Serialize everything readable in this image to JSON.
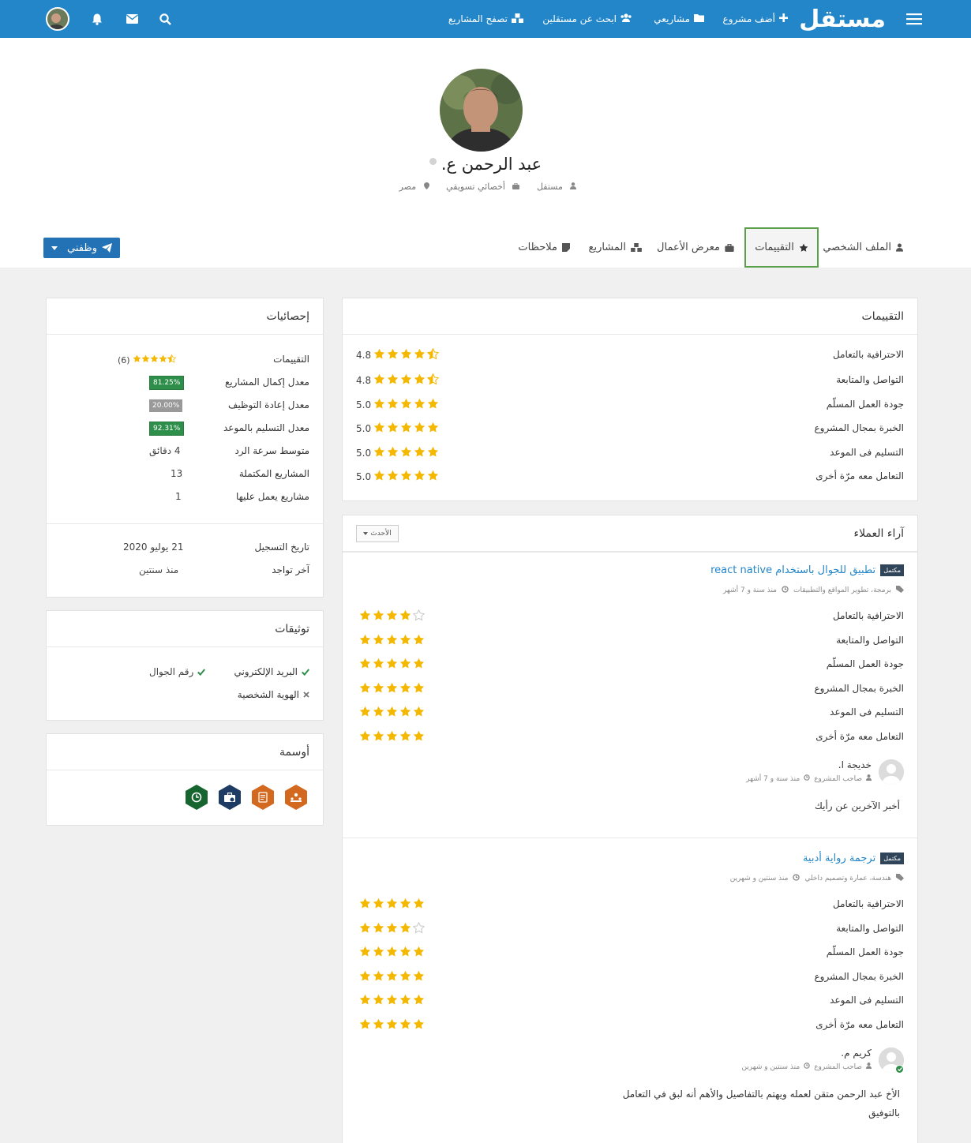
{
  "colors": {
    "primary": "#2386c8",
    "star": "#f5b800",
    "green": "#2e8f4b",
    "active_tab_border": "#5ba14b",
    "hire_button": "#2372b5"
  },
  "nav": {
    "logo": "مستقل",
    "add_project": "أضف مشروع",
    "my_projects": "مشاريعي",
    "find_freelancers": "ابحث عن مستقلين",
    "browse_projects": "تصفح المشاريع",
    "icons": [
      "menu-icon",
      "plus-icon",
      "folder-icon",
      "users-icon",
      "cubes-icon",
      "search-icon",
      "envelope-icon",
      "bell-icon"
    ]
  },
  "profile": {
    "name": "عبد الرحمن ع.",
    "site": "مستقل",
    "job": "أخصائي تسويقي",
    "country": "مصر"
  },
  "tabs": [
    "الملف الشخصي",
    "التقييمات",
    "معرض الأعمال",
    "المشاريع",
    "ملاحظات"
  ],
  "active_tab": "التقييمات",
  "hire_button": "وظفني",
  "ratings": {
    "title": "التقييمات",
    "items": [
      {
        "label": "الاحترافية بالتعامل",
        "value": "4.8",
        "stars": 4.5
      },
      {
        "label": "التواصل والمتابعة",
        "value": "4.8",
        "stars": 4.5
      },
      {
        "label": "جودة العمل المسلّم",
        "value": "5.0",
        "stars": 5
      },
      {
        "label": "الخبرة بمجال المشروع",
        "value": "5.0",
        "stars": 5
      },
      {
        "label": "التسليم فى الموعد",
        "value": "5.0",
        "stars": 5
      },
      {
        "label": "التعامل معه مرّة أخرى",
        "value": "5.0",
        "stars": 5
      }
    ]
  },
  "reviews": {
    "title": "آراء العملاء",
    "sort": "الأحدث",
    "items": [
      {
        "status": "مكتمل",
        "title": "تطبيق للجوال باستخدام react native",
        "tags": "برمجة، تطوير المواقع والتطبيقات",
        "time": "منذ سنة و 7 أشهر",
        "criteria": [
          {
            "label": "الاحترافية بالتعامل",
            "stars": 4
          },
          {
            "label": "التواصل والمتابعة",
            "stars": 5
          },
          {
            "label": "جودة العمل المسلّم",
            "stars": 5
          },
          {
            "label": "الخبرة بمجال المشروع",
            "stars": 5
          },
          {
            "label": "التسليم فى الموعد",
            "stars": 5
          },
          {
            "label": "التعامل معه مرّة أخرى",
            "stars": 5
          }
        ],
        "reviewer": "خديجة ا.",
        "role": "صاحب المشروع",
        "review_time": "منذ سنة و 7 أشهر",
        "comment": "أخبر الآخرين عن رأيك"
      },
      {
        "status": "مكتمل",
        "title": "ترجمة رواية أدبية",
        "tags": "هندسة، عمارة وتصميم داخلي",
        "time": "منذ سنتين و شهرين",
        "criteria": [
          {
            "label": "الاحترافية بالتعامل",
            "stars": 5
          },
          {
            "label": "التواصل والمتابعة",
            "stars": 4
          },
          {
            "label": "جودة العمل المسلّم",
            "stars": 5
          },
          {
            "label": "الخبرة بمجال المشروع",
            "stars": 5
          },
          {
            "label": "التسليم فى الموعد",
            "stars": 5
          },
          {
            "label": "التعامل معه مرّة أخرى",
            "stars": 5
          }
        ],
        "reviewer": "كريم م.",
        "role": "صاحب المشروع",
        "review_time": "منذ سنتين و شهرين",
        "comment_line1": "الأخ عبد الرحمن متقن لعمله ويهتم بالتفاصيل والأهم أنه لبق في التعامل",
        "comment_line2": "بالتوفيق"
      }
    ]
  },
  "stats": {
    "title": "إحصائيات",
    "rating_label": "التقييمات",
    "rating_count": "(6)",
    "rating_stars": 4.5,
    "completion_label": "معدل إكمال المشاريع",
    "completion": "81.25%",
    "rehire_label": "معدل إعادة التوظيف",
    "rehire": "20.00%",
    "ontime_label": "معدل التسليم بالموعد",
    "ontime": "92.31%",
    "response_label": "متوسط سرعة الرد",
    "response": "4 دقائق",
    "completed_label": "المشاريع المكتملة",
    "completed": "13",
    "active_label": "مشاريع يعمل عليها",
    "active": "1",
    "registered_label": "تاريخ التسجيل",
    "registered": "21 يوليو 2020",
    "last_seen_label": "آخر تواجد",
    "last_seen": "منذ سنتين"
  },
  "verifications": {
    "title": "توثيقات",
    "email": "البريد الإلكتروني",
    "phone": "رقم الجوال",
    "identity": "الهوية الشخصية"
  },
  "badges": {
    "title": "أوسمة",
    "items": [
      {
        "icon": "team-icon",
        "color": "#d3691e"
      },
      {
        "icon": "certificate-icon",
        "color": "#d3691e"
      },
      {
        "icon": "briefcase-check-icon",
        "color": "#1d3b63"
      },
      {
        "icon": "clock-icon",
        "color": "#17652e"
      }
    ]
  }
}
